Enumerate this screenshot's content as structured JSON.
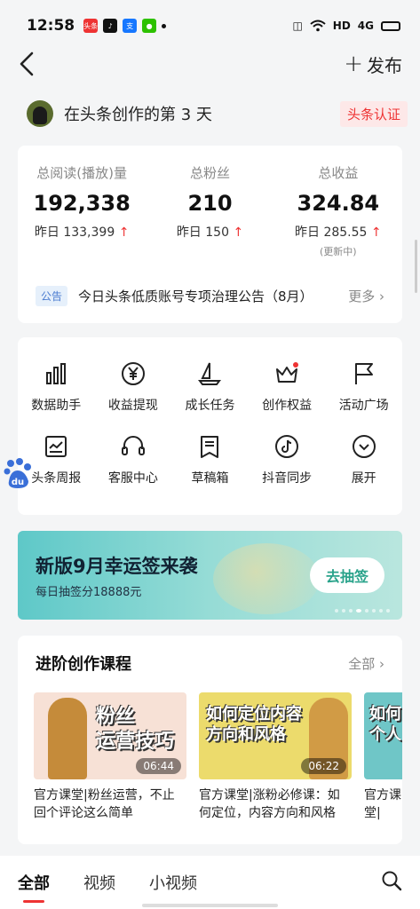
{
  "status_bar": {
    "time": "12:58",
    "apps": [
      {
        "name": "toutiao-app-icon",
        "label": "头条",
        "color": "#e33"
      },
      {
        "name": "tiktok-app-icon",
        "label": "",
        "color": "#111"
      },
      {
        "name": "alipay-app-icon",
        "label": "支",
        "color": "#1677ff"
      },
      {
        "name": "wechat-app-icon",
        "label": "",
        "color": "#2dc100"
      }
    ],
    "network": "HD",
    "signal": "4G"
  },
  "header": {
    "back_icon": "back-arrow-icon",
    "publish_label": "发布"
  },
  "creator": {
    "text": "在头条创作的第 3 天",
    "badge": "头条认证"
  },
  "stats": [
    {
      "label": "总阅读(播放)量",
      "value": "192,338",
      "yesterday": "昨日 133,399",
      "note": ""
    },
    {
      "label": "总粉丝",
      "value": "210",
      "yesterday": "昨日 150",
      "note": ""
    },
    {
      "label": "总收益",
      "value": "324.84",
      "yesterday": "昨日 285.55",
      "note": "(更新中)"
    }
  ],
  "notice": {
    "tag": "公告",
    "text": "今日头条低质账号专项治理公告（8月）",
    "more": "更多"
  },
  "tools": [
    {
      "label": "数据助手",
      "icon": "bar-chart-icon"
    },
    {
      "label": "收益提现",
      "icon": "yen-circle-icon"
    },
    {
      "label": "成长任务",
      "icon": "sailboat-icon"
    },
    {
      "label": "创作权益",
      "icon": "crown-icon"
    },
    {
      "label": "活动广场",
      "icon": "flag-icon"
    },
    {
      "label": "头条周报",
      "icon": "report-chart-icon"
    },
    {
      "label": "客服中心",
      "icon": "headset-icon"
    },
    {
      "label": "草稿箱",
      "icon": "draft-box-icon"
    },
    {
      "label": "抖音同步",
      "icon": "tiktok-icon"
    },
    {
      "label": "展开",
      "icon": "expand-chevron-icon"
    }
  ],
  "banner": {
    "title": "新版9月幸运签来袭",
    "subtitle": "每日抽签分18888元",
    "button": "去抽签",
    "dots": 8,
    "active_dot": 3
  },
  "courses": {
    "title": "进阶创作课程",
    "more": "全部",
    "items": [
      {
        "thumb_text": "粉丝\n运营技巧",
        "duration": "06:44",
        "desc": "官方课堂|粉丝运营，不止回个评论这么简单"
      },
      {
        "thumb_text": "如何定位内容\n方向和风格",
        "duration": "06:22",
        "desc": "官方课堂|涨粉必修课：如何定位，内容方向和风格"
      },
      {
        "thumb_text": "如何\n个人",
        "duration": "",
        "desc": "官方课堂|\n做？打"
      }
    ]
  },
  "bottom_nav": {
    "tabs": [
      "全部",
      "视频",
      "小视频"
    ],
    "active": 0
  },
  "colors": {
    "accent_red": "#e33",
    "banner_teal": "#5ec8c8",
    "notice_blue": "#4a7bd0"
  }
}
